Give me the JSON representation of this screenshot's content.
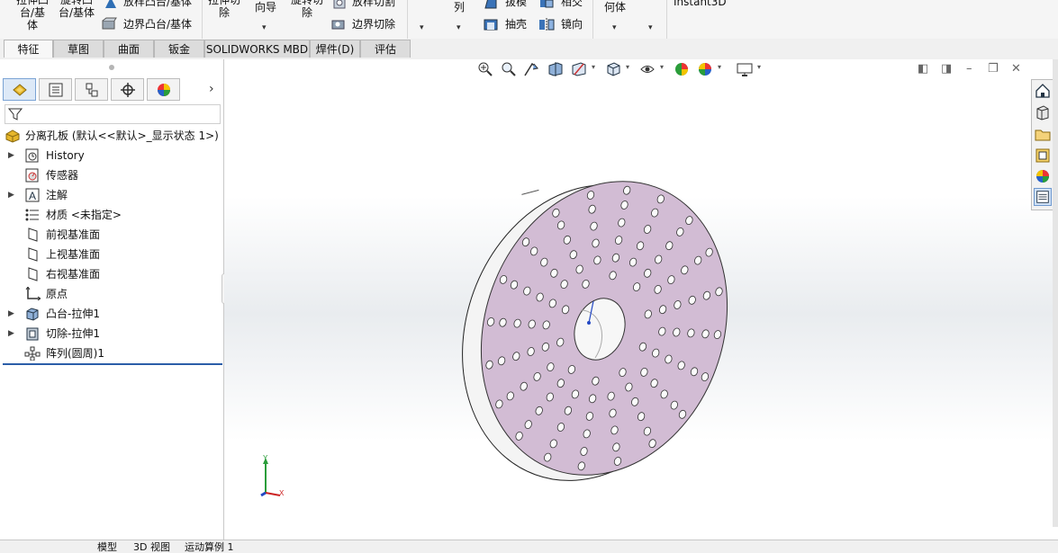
{
  "ribbon": {
    "extrude_boss": "拉伸凸台/基体",
    "revolve_boss": "旋转凸台/基体",
    "loft_boss": "放样凸台/基体",
    "boundary_boss": "边界凸台/基体",
    "extrude_cut": "拉伸切除",
    "hole_wizard": "向导",
    "revolve_cut": "旋转切除",
    "loft_cut": "放样切割",
    "boundary_cut": "边界切除",
    "pattern": "列",
    "draft": "拔模",
    "intersect": "相交",
    "shell": "抽壳",
    "mirror": "镜向",
    "ref_geometry": "何体",
    "instant3d": "Instant3D"
  },
  "tabs": [
    {
      "label": "特征",
      "active": true
    },
    {
      "label": "草图",
      "active": false
    },
    {
      "label": "曲面",
      "active": false
    },
    {
      "label": "钣金",
      "active": false
    },
    {
      "label": "SOLIDWORKS MBD",
      "active": false
    },
    {
      "label": "焊件(D)",
      "active": false
    },
    {
      "label": "评估",
      "active": false
    }
  ],
  "panel": {
    "tab_icons": [
      "feature-manager-icon",
      "property-manager-icon",
      "configuration-manager-icon",
      "dimxpert-icon",
      "display-manager-icon"
    ]
  },
  "tree": {
    "root": "分离孔板  (默认<<默认>_显示状态 1>)",
    "items": [
      {
        "label": "History",
        "expandable": true,
        "icon": "history-icon"
      },
      {
        "label": "传感器",
        "expandable": false,
        "icon": "sensor-icon"
      },
      {
        "label": "注解",
        "expandable": true,
        "icon": "annotation-icon"
      },
      {
        "label": "材质 <未指定>",
        "expandable": false,
        "icon": "material-icon"
      },
      {
        "label": "前视基准面",
        "expandable": false,
        "icon": "plane-icon"
      },
      {
        "label": "上视基准面",
        "expandable": false,
        "icon": "plane-icon"
      },
      {
        "label": "右视基准面",
        "expandable": false,
        "icon": "plane-icon"
      },
      {
        "label": "原点",
        "expandable": false,
        "icon": "origin-icon"
      },
      {
        "label": "凸台-拉伸1",
        "expandable": true,
        "icon": "boss-extrude-icon"
      },
      {
        "label": "切除-拉伸1",
        "expandable": true,
        "icon": "cut-extrude-icon"
      },
      {
        "label": "阵列(圆周)1",
        "expandable": false,
        "icon": "circular-pattern-icon"
      }
    ]
  },
  "viewport": {
    "model_face_color": "#d2bcd4",
    "model_edge_color": "#f4f4f4",
    "triad": {
      "y": "Y",
      "x": "X"
    }
  },
  "bottom_tabs": [
    "模型",
    "3D 视图",
    "运动算例 1"
  ]
}
